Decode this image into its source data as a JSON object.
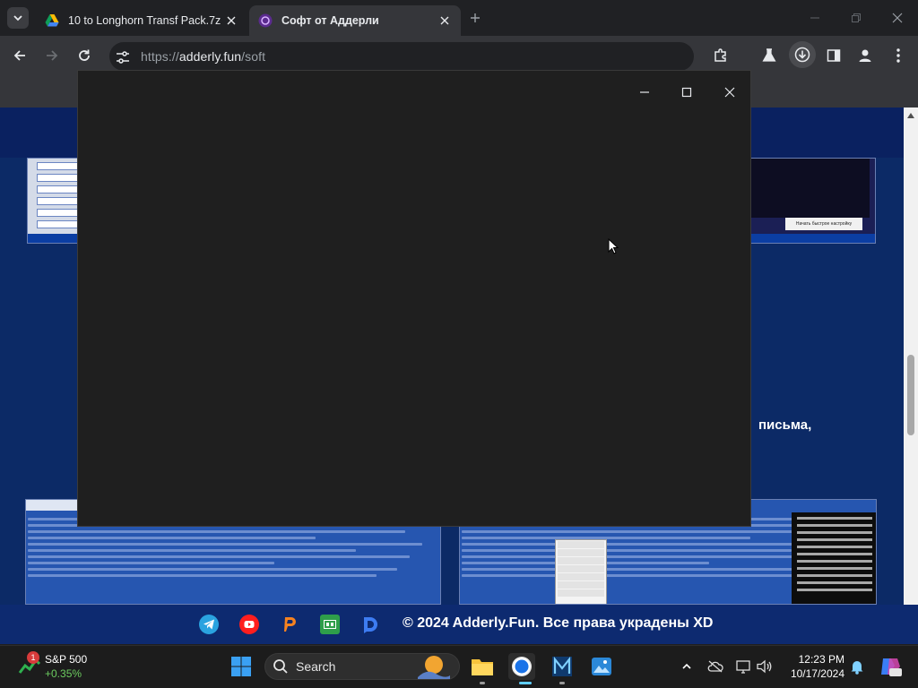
{
  "browser": {
    "tabs": [
      {
        "title": "10 to Longhorn Transf Pack.7z",
        "active": false
      },
      {
        "title": "Софт от Аддерли",
        "active": true
      }
    ],
    "url": {
      "scheme": "https://",
      "host": "adderly.fun",
      "path": "/soft"
    },
    "accent": "#35363a"
  },
  "page": {
    "partial_heading": "письма,",
    "preview_button": "Начать быстрое настройку",
    "footer": {
      "copyright": "© 2024 Adderly.Fun. Все права украдены XD",
      "social_icons": [
        "telegram-icon",
        "youtube-icon",
        "boosty-icon",
        "gamejolt-icon",
        "donationalerts-icon"
      ]
    }
  },
  "taskbar": {
    "widget": {
      "name": "S&P 500",
      "change": "+0.35%",
      "badge": "1"
    },
    "search_label": "Search",
    "clock": {
      "time": "12:23 PM",
      "date": "10/17/2024"
    }
  }
}
